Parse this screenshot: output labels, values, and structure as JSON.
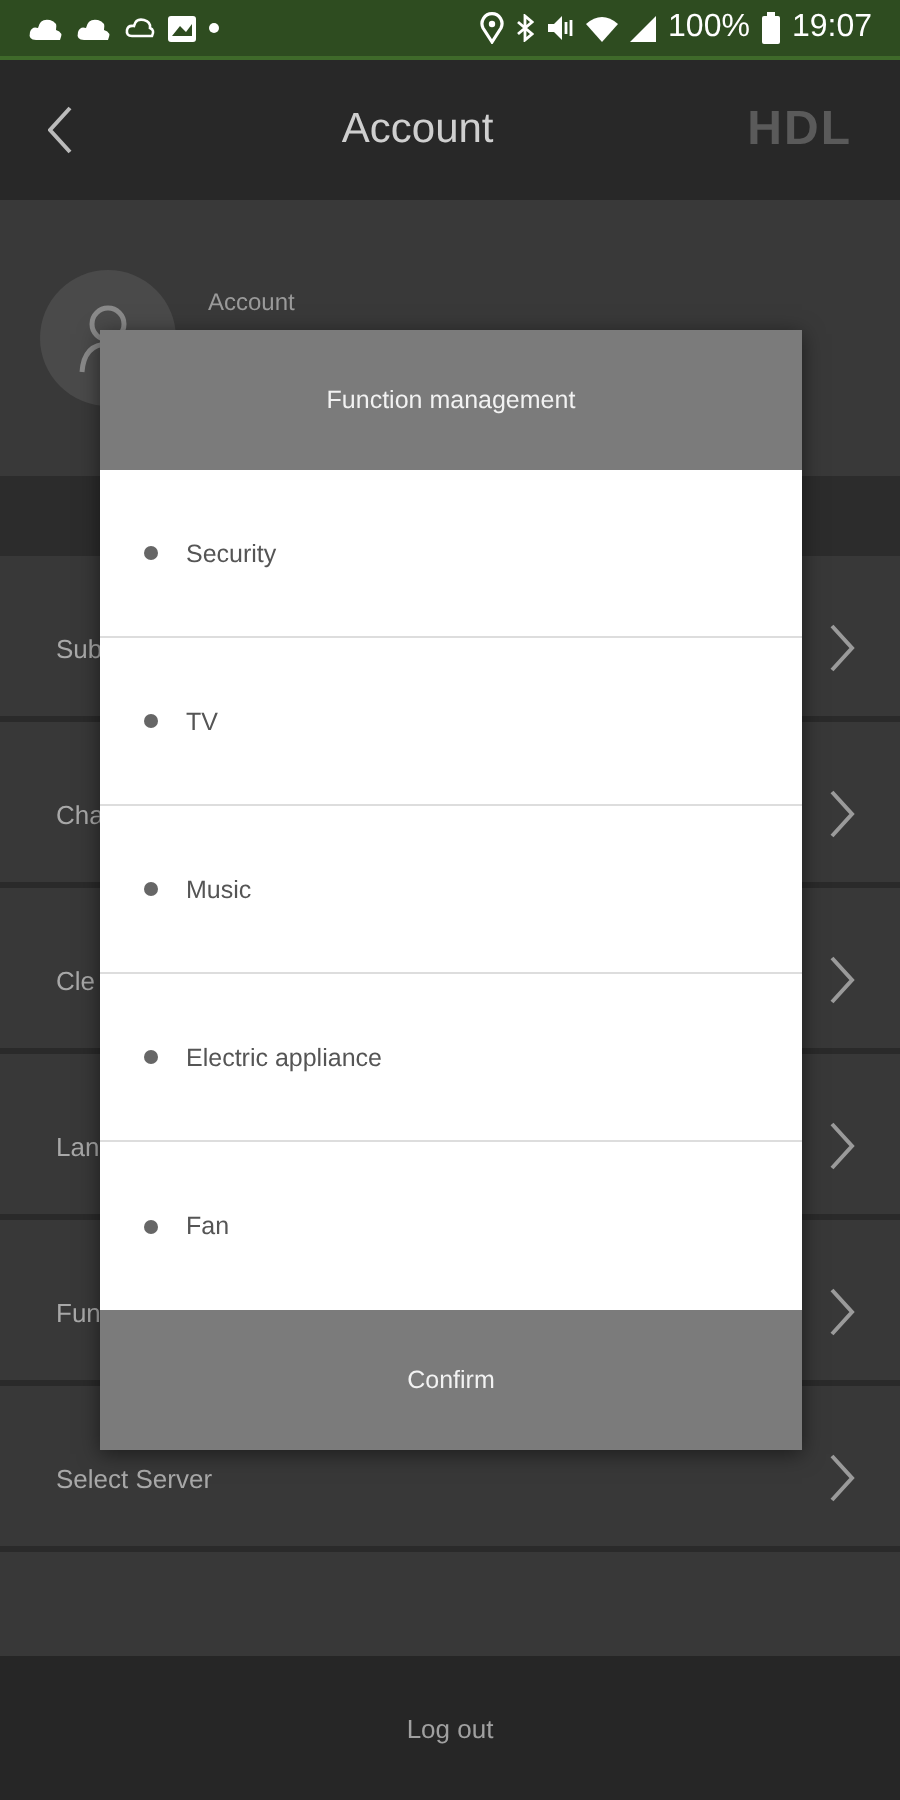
{
  "status_bar": {
    "battery": "100%",
    "time": "19:07"
  },
  "header": {
    "title": "Account",
    "logo": "HDL"
  },
  "profile": {
    "label": "Account"
  },
  "menu_rows": [
    {
      "label": "Sub"
    },
    {
      "label": "Cha"
    },
    {
      "label": "Cle"
    },
    {
      "label": "Lan"
    },
    {
      "label": "Fun"
    },
    {
      "label": "Select Server"
    }
  ],
  "footer": {
    "button": "Log out"
  },
  "dialog": {
    "title": "Function management",
    "items": [
      {
        "label": "Security"
      },
      {
        "label": "TV"
      },
      {
        "label": "Music"
      },
      {
        "label": "Electric appliance"
      },
      {
        "label": "Fan"
      }
    ],
    "confirm": "Confirm"
  }
}
